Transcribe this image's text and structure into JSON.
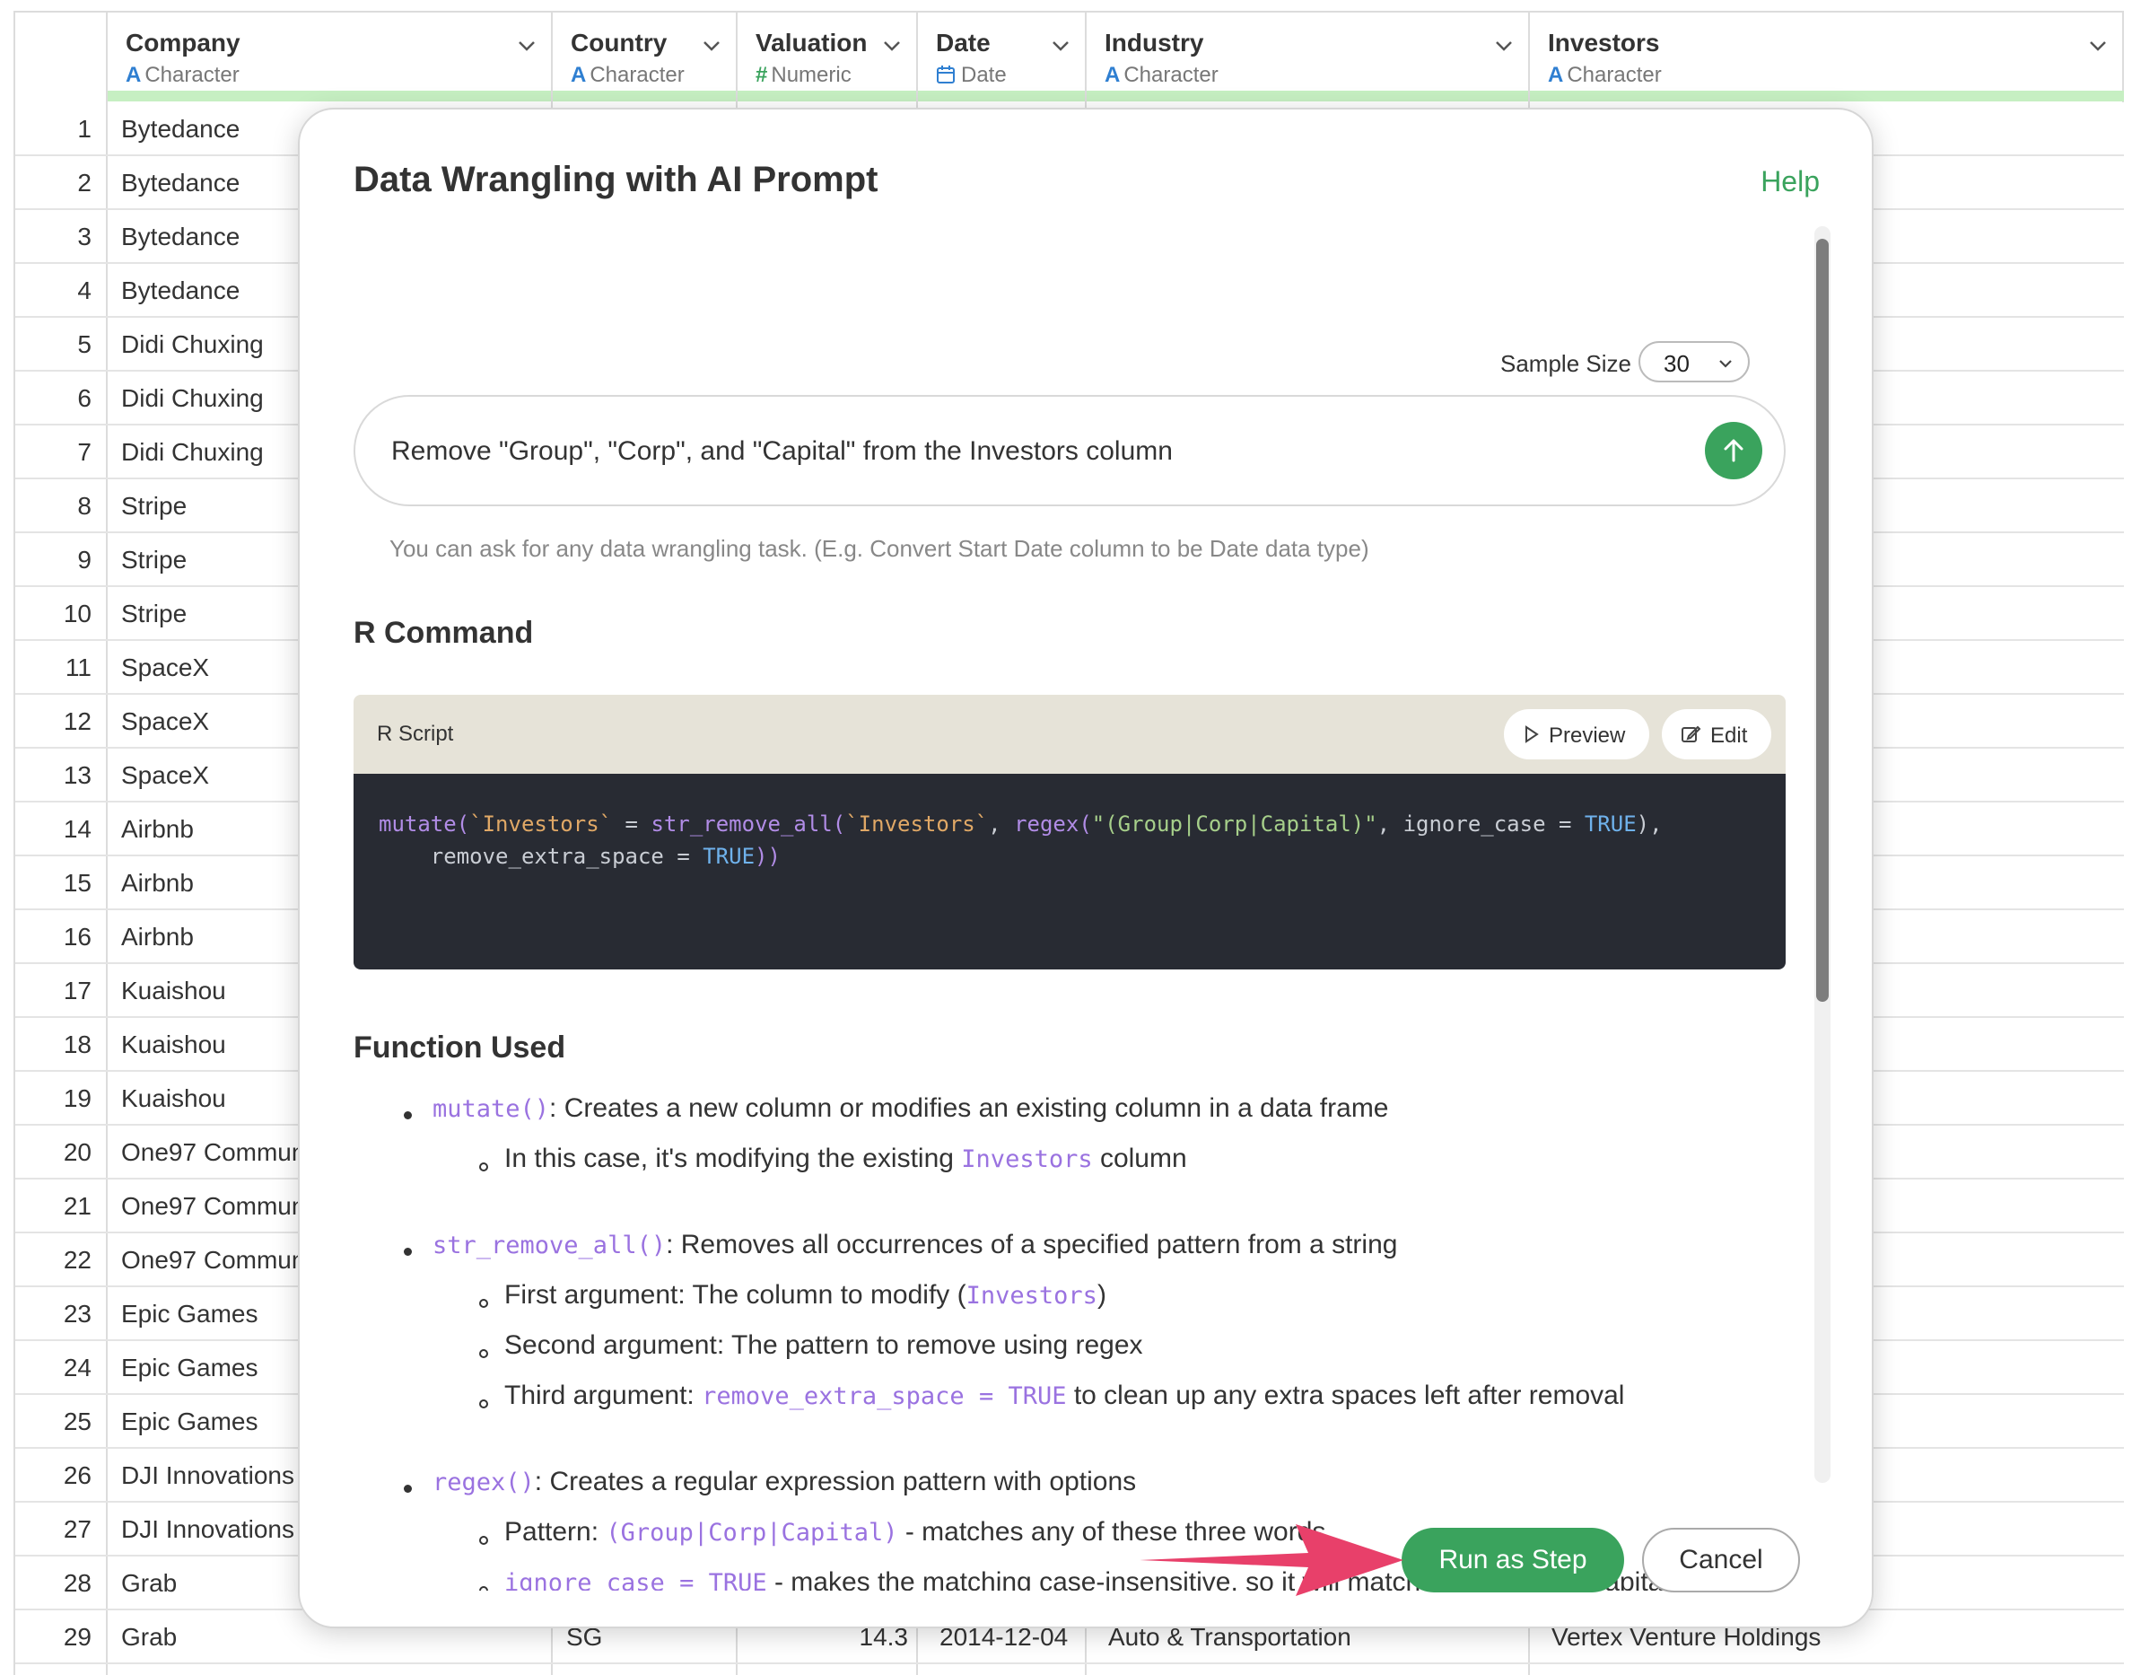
{
  "grid": {
    "columns": [
      {
        "name": "Company",
        "type": "Character",
        "type_icon": "A"
      },
      {
        "name": "Country",
        "type": "Character",
        "type_icon": "A"
      },
      {
        "name": "Valuation",
        "type": "Numeric",
        "type_icon": "#"
      },
      {
        "name": "Date",
        "type": "Date",
        "type_icon": "calendar-icon"
      },
      {
        "name": "Industry",
        "type": "Character",
        "type_icon": "A"
      },
      {
        "name": "Investors",
        "type": "Character",
        "type_icon": "A"
      }
    ],
    "rows": [
      {
        "n": "1",
        "company": "Bytedance"
      },
      {
        "n": "2",
        "company": "Bytedance"
      },
      {
        "n": "3",
        "company": "Bytedance"
      },
      {
        "n": "4",
        "company": "Bytedance"
      },
      {
        "n": "5",
        "company": "Didi Chuxing"
      },
      {
        "n": "6",
        "company": "Didi Chuxing"
      },
      {
        "n": "7",
        "company": "Didi Chuxing"
      },
      {
        "n": "8",
        "company": "Stripe"
      },
      {
        "n": "9",
        "company": "Stripe"
      },
      {
        "n": "10",
        "company": "Stripe"
      },
      {
        "n": "11",
        "company": "SpaceX"
      },
      {
        "n": "12",
        "company": "SpaceX"
      },
      {
        "n": "13",
        "company": "SpaceX"
      },
      {
        "n": "14",
        "company": "Airbnb"
      },
      {
        "n": "15",
        "company": "Airbnb"
      },
      {
        "n": "16",
        "company": "Airbnb"
      },
      {
        "n": "17",
        "company": "Kuaishou"
      },
      {
        "n": "18",
        "company": "Kuaishou"
      },
      {
        "n": "19",
        "company": "Kuaishou"
      },
      {
        "n": "20",
        "company": "One97 Commun"
      },
      {
        "n": "21",
        "company": "One97 Commun"
      },
      {
        "n": "22",
        "company": "One97 Commun"
      },
      {
        "n": "23",
        "company": "Epic Games"
      },
      {
        "n": "24",
        "company": "Epic Games"
      },
      {
        "n": "25",
        "company": "Epic Games"
      },
      {
        "n": "26",
        "company": "DJI Innovations"
      },
      {
        "n": "27",
        "company": "DJI Innovations"
      },
      {
        "n": "28",
        "company": "Grab"
      },
      {
        "n": "29",
        "company": "Grab",
        "country": "SG",
        "valuation": "14.3",
        "date": "2014-12-04",
        "industry": "Auto & Transportation",
        "investors": "Vertex Venture Holdings"
      }
    ]
  },
  "modal": {
    "title": "Data Wrangling with AI Prompt",
    "help": "Help",
    "sample_size_label": "Sample Size",
    "sample_size_value": "30",
    "prompt": "Remove \"Group\", \"Corp\", and \"Capital\" from the Investors column",
    "hint": "You can ask for any data wrangling task. (E.g. Convert Start Date column to be Date data type)",
    "r_command_title": "R Command",
    "r_script_label": "R Script",
    "preview_label": "Preview",
    "edit_label": "Edit",
    "code": {
      "l1_fn": "mutate(",
      "l1_col": "`Investors`",
      "l1_eq": " = ",
      "l1_fn2": "str_remove_all(",
      "l1_col2": "`Investors`",
      "l1_comma": ", ",
      "l1_fn3": "regex(",
      "l1_str": "\"(Group|Corp|Capital)\"",
      "l1_arg": ", ignore_case = ",
      "l1_true": "TRUE",
      "l1_end": "),",
      "l2_arg": "    remove_extra_space = ",
      "l2_true": "TRUE",
      "l2_end": "))"
    },
    "function_used_title": "Function Used",
    "functions": {
      "f1_name": "mutate()",
      "f1_desc": ": Creates a new column or modifies an existing column in a data frame",
      "f1_s1_pre": "In this case, it's modifying the existing ",
      "f1_s1_code": "Investors",
      "f1_s1_post": " column",
      "f2_name": "str_remove_all()",
      "f2_desc": ": Removes all occurrences of a specified pattern from a string",
      "f2_s1_pre": "First argument: The column to modify (",
      "f2_s1_code": "Investors",
      "f2_s1_post": ")",
      "f2_s2": "Second argument: The pattern to remove using regex",
      "f2_s3_pre": "Third argument: ",
      "f2_s3_code": "remove_extra_space = TRUE",
      "f2_s3_post": " to clean up any extra spaces left after removal",
      "f3_name": "regex()",
      "f3_desc": ": Creates a regular expression pattern with options",
      "f3_s1_pre": "Pattern: ",
      "f3_s1_code": "(Group|Corp|Capital)",
      "f3_s1_post": " - matches any of these three words",
      "f3_s2_code": "ignore_case = TRUE",
      "f3_s2_post": " - makes the matching case-insensitive, so it will match regardless of capitalization"
    },
    "run_label": "Run as Step",
    "cancel_label": "Cancel"
  },
  "colors": {
    "accent": "#3aa35d",
    "arrow": "#e8406a",
    "code_bg": "#282b33",
    "type_icon": "#2f7fd1"
  }
}
